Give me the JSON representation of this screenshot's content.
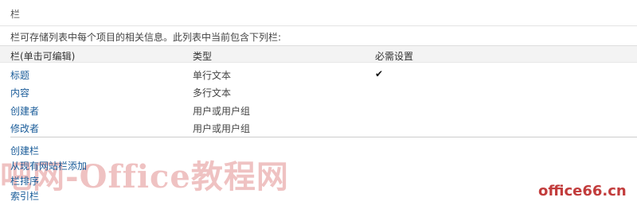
{
  "section": {
    "title": "栏",
    "description": "栏可存储列表中每个项目的相关信息。此列表中当前包含下列栏:"
  },
  "table": {
    "headers": [
      "栏(单击可编辑)",
      "类型",
      "必需设置"
    ],
    "rows": [
      {
        "name": "标题",
        "type": "单行文本",
        "required": "✔"
      },
      {
        "name": "内容",
        "type": "多行文本",
        "required": ""
      },
      {
        "name": "创建者",
        "type": "用户或用户组",
        "required": ""
      },
      {
        "name": "修改者",
        "type": "用户或用户组",
        "required": ""
      }
    ]
  },
  "actions": [
    "创建栏",
    "从现有网站栏添加",
    "栏排序",
    "索引栏"
  ],
  "watermark": {
    "text": "吧网-Office教程网",
    "site": "office66.cn"
  },
  "colors": {
    "link": "#1a5c99",
    "watermark": "#d25050"
  }
}
